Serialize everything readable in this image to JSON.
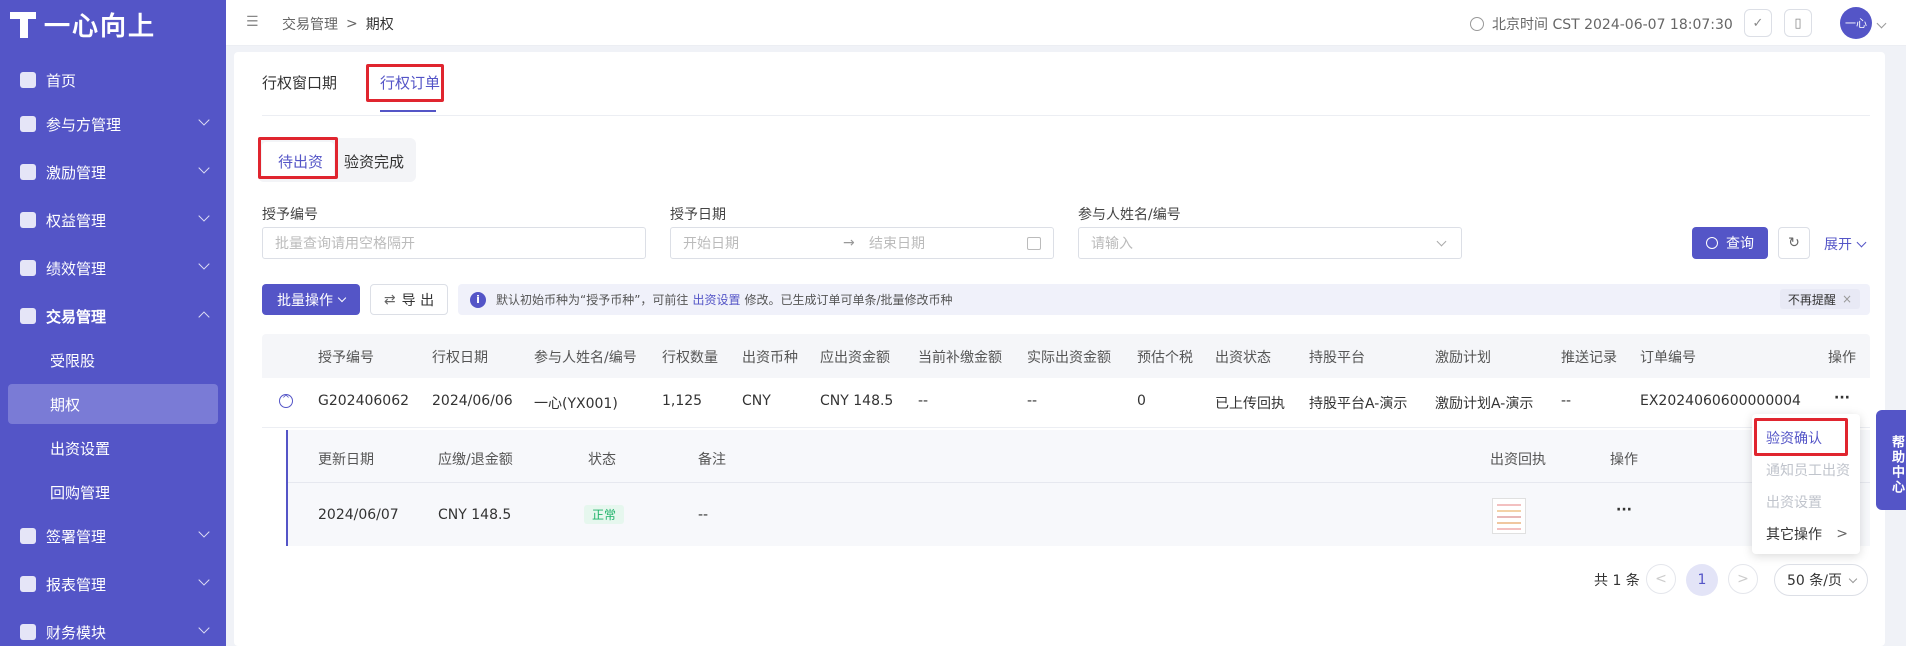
{
  "brand": {
    "name": "一心向上"
  },
  "sidebar": {
    "items": [
      {
        "label": "首页",
        "icon": "home-icon"
      },
      {
        "label": "参与方管理",
        "icon": "users-icon"
      },
      {
        "label": "激励管理",
        "icon": "incentive-icon"
      },
      {
        "label": "权益管理",
        "icon": "equity-icon"
      },
      {
        "label": "绩效管理",
        "icon": "performance-icon"
      },
      {
        "label": "交易管理",
        "icon": "trade-icon"
      },
      {
        "label": "受限股"
      },
      {
        "label": "期权"
      },
      {
        "label": "出资设置"
      },
      {
        "label": "回购管理"
      },
      {
        "label": "签署管理",
        "icon": "sign-icon"
      },
      {
        "label": "报表管理",
        "icon": "report-icon"
      },
      {
        "label": "财务模块",
        "icon": "finance-icon"
      }
    ]
  },
  "header": {
    "breadcrumb": [
      "交易管理",
      "期权"
    ],
    "breadcrumb_sep": ">",
    "time": "北京时间 CST 2024-06-07 18:07:30",
    "avatar": "一心"
  },
  "tabs": [
    "行权窗口期",
    "行权订单"
  ],
  "subtabs": [
    "待出资",
    "验资完成"
  ],
  "filters": {
    "grant_no": {
      "label": "授予编号",
      "placeholder": "批量查询请用空格隔开"
    },
    "grant_date": {
      "label": "授予日期",
      "start": "开始日期",
      "end": "结束日期",
      "arrow": "→"
    },
    "participant": {
      "label": "参与人姓名/编号",
      "placeholder": "请输入"
    },
    "query": "查询",
    "expand": "展开"
  },
  "toolbar": {
    "batch": "批量操作",
    "export": "导 出",
    "notice_pre": "默认初始币种为“授予币种”，可前往",
    "notice_link": "出资设置",
    "notice_post": "修改。已生成订单可单条/批量修改币种",
    "dismiss": "不再提醒",
    "dismiss_x": "×"
  },
  "table": {
    "columns": [
      "授予编号",
      "行权日期",
      "参与人姓名/编号",
      "行权数量",
      "出资币种",
      "应出资金额",
      "当前补缴金额",
      "实际出资金额",
      "预估个税",
      "出资状态",
      "持股平台",
      "激励计划",
      "推送记录",
      "订单编号",
      "操作"
    ],
    "row": [
      "G202406062",
      "2024/06/06",
      "一心(YX001)",
      "1,125",
      "CNY",
      "CNY 148.5",
      "--",
      "--",
      "0",
      "已上传回执",
      "持股平台A-演示",
      "激励计划A-演示",
      "--",
      "EX2024060600000004",
      "···"
    ]
  },
  "subtable": {
    "columns": [
      "更新日期",
      "应缴/退金额",
      "状态",
      "备注",
      "出资回执",
      "操作"
    ],
    "row": {
      "date": "2024/06/07",
      "amount": "CNY 148.5",
      "status": "正常",
      "remark": "--",
      "ops": "···"
    }
  },
  "dropdown": {
    "items": [
      "验资确认",
      "通知员工出资",
      "出资设置",
      "其它操作"
    ],
    "more": ">"
  },
  "pagination": {
    "total": "共 1 条",
    "page": "1",
    "prev": "<",
    "next": ">",
    "size": "50 条/页"
  },
  "help": "帮助中心",
  "colors": {
    "primary": "#5455c7",
    "highlight": "#e0252f",
    "status_ok": "#1fb36a"
  }
}
